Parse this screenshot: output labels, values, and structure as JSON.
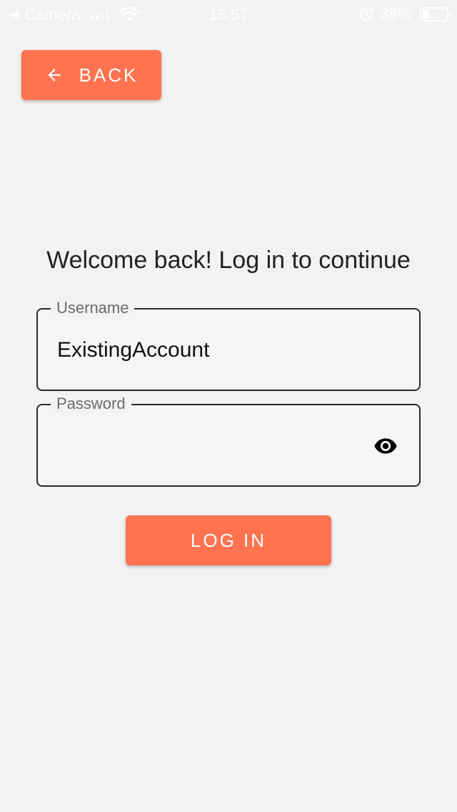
{
  "status_bar": {
    "back_app": "Camera",
    "time": "16:57",
    "battery_percent": "38%",
    "battery_level": 0.38
  },
  "back_button": {
    "label": "BACK",
    "icon": "arrow-left-icon"
  },
  "title": "Welcome back! Log in to continue",
  "form": {
    "username": {
      "label": "Username",
      "value": "ExistingAccount"
    },
    "password": {
      "label": "Password",
      "value": "",
      "visibility_icon": "eye-icon"
    }
  },
  "login_button": {
    "label": "LOG IN"
  },
  "colors": {
    "accent": "#ff7350",
    "background": "#f2f2f2",
    "field_border": "#2a2a2a"
  }
}
